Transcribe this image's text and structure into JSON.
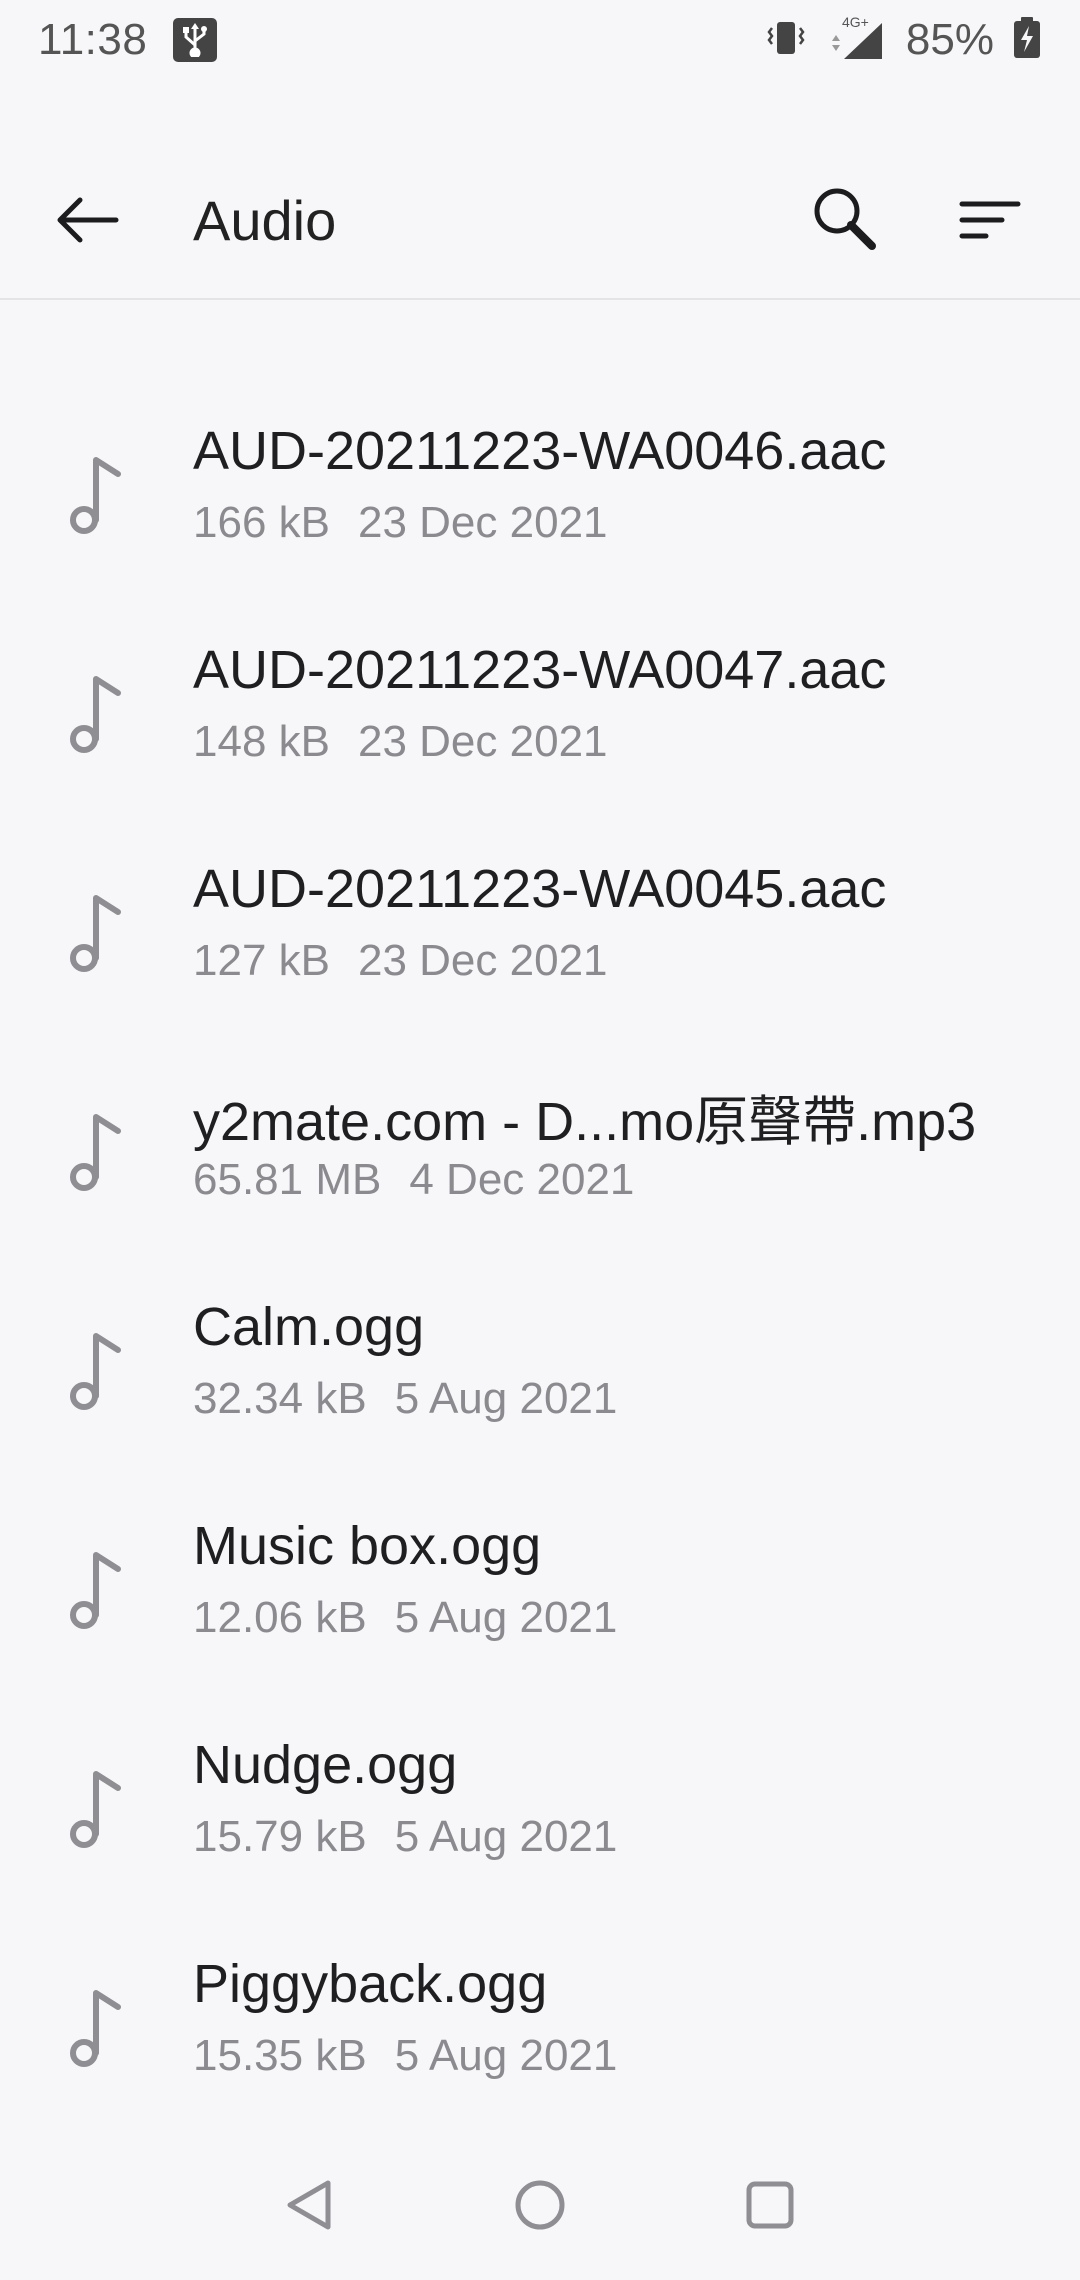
{
  "status_bar": {
    "time": "11:38",
    "battery": "85%",
    "network": "4G+",
    "icons": [
      "usb-icon",
      "vibrate-icon",
      "signal-icon",
      "battery-charging-icon"
    ]
  },
  "app_bar": {
    "title": "Audio",
    "icons": [
      "back-arrow-icon",
      "search-icon",
      "sort-icon"
    ]
  },
  "files": [
    {
      "name": "AUD-20211223-WA0046.aac",
      "size": "166 kB",
      "date": "23 Dec 2021"
    },
    {
      "name": "AUD-20211223-WA0047.aac",
      "size": "148 kB",
      "date": "23 Dec 2021"
    },
    {
      "name": "AUD-20211223-WA0045.aac",
      "size": "127 kB",
      "date": "23 Dec 2021"
    },
    {
      "name": "y2mate.com - D...mo原聲帶.mp3",
      "size": "65.81 MB",
      "date": "4 Dec 2021"
    },
    {
      "name": "Calm.ogg",
      "size": "32.34 kB",
      "date": "5 Aug 2021"
    },
    {
      "name": "Music box.ogg",
      "size": "12.06 kB",
      "date": "5 Aug 2021"
    },
    {
      "name": "Nudge.ogg",
      "size": "15.79 kB",
      "date": "5 Aug 2021"
    },
    {
      "name": "Piggyback.ogg",
      "size": "15.35 kB",
      "date": "5 Aug 2021"
    }
  ],
  "nav_bar": {
    "icons": [
      "back-triangle-icon",
      "home-circle-icon",
      "recents-square-icon"
    ]
  }
}
